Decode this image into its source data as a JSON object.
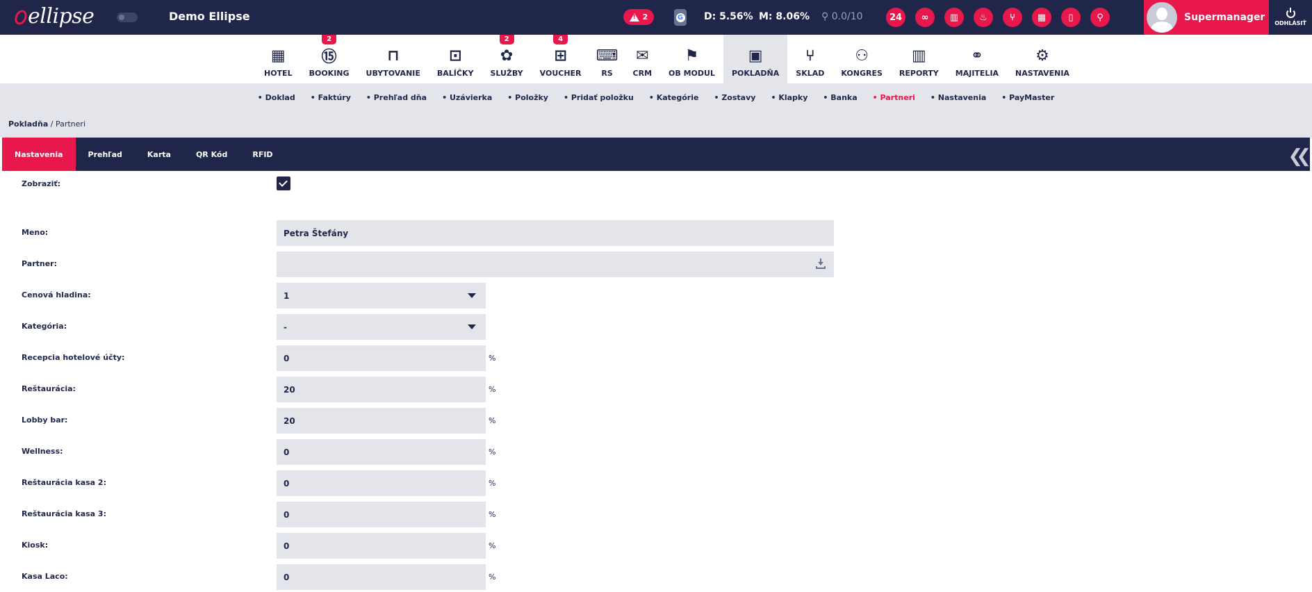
{
  "app": {
    "logo": "ellipse",
    "hotel_name": "Demo Ellipse"
  },
  "topbar": {
    "alert_count": "2",
    "stat_d": "D: 5.56%",
    "stat_m": "M: 8.06%",
    "stat_p": "0.0/10",
    "user_name": "Supermanager",
    "logout_label": "ODHLÁSIŤ"
  },
  "mainnav": [
    {
      "label": "HOTEL",
      "icon": "hotel-icon",
      "badge": ""
    },
    {
      "label": "BOOKING",
      "icon": "calendar-icon",
      "badge": "2"
    },
    {
      "label": "UBYTOVANIE",
      "icon": "bed-icon",
      "badge": ""
    },
    {
      "label": "BALÍČKY",
      "icon": "package-icon",
      "badge": ""
    },
    {
      "label": "SLUŽBY",
      "icon": "lotus-icon",
      "badge": "2"
    },
    {
      "label": "VOUCHER",
      "icon": "gift-icon",
      "badge": "4"
    },
    {
      "label": "RS",
      "icon": "code-window-icon",
      "badge": ""
    },
    {
      "label": "CRM",
      "icon": "mail-icon",
      "badge": ""
    },
    {
      "label": "OB MODUL",
      "icon": "traveler-icon",
      "badge": ""
    },
    {
      "label": "POKLADŇA",
      "icon": "wallet-icon",
      "badge": ""
    },
    {
      "label": "SKLAD",
      "icon": "cutlery-icon",
      "badge": ""
    },
    {
      "label": "KONGRES",
      "icon": "group-icon",
      "badge": ""
    },
    {
      "label": "REPORTY",
      "icon": "bar-chart-icon",
      "badge": ""
    },
    {
      "label": "MAJITELIA",
      "icon": "handshake-icon",
      "badge": ""
    },
    {
      "label": "NASTAVENIA",
      "icon": "gears-icon",
      "badge": ""
    }
  ],
  "subnav": [
    "Doklad",
    "Faktúry",
    "Prehľad dňa",
    "Uzávierka",
    "Položky",
    "Pridať položku",
    "Kategórie",
    "Zostavy",
    "Klapky",
    "Banka",
    "Partneri",
    "Nastavenia",
    "PayMaster"
  ],
  "breadcrumb": {
    "root": "Pokladňa",
    "current": "/ Partneri"
  },
  "tabs": [
    "Nastavenia",
    "Prehľad",
    "Karta",
    "QR Kód",
    "RFID"
  ],
  "form": {
    "zobrazit_label": "Zobraziť:",
    "meno_label": "Meno:",
    "meno_value": "Petra Štefány",
    "partner_label": "Partner:",
    "partner_value": "",
    "cenova_label": "Cenová hladina:",
    "cenova_value": "1",
    "kategoria_label": "Kategória:",
    "kategoria_value": "-",
    "percent": "%",
    "discounts": [
      {
        "label": "Recepcia hotelové účty:",
        "value": "0"
      },
      {
        "label": "Reštaurácia:",
        "value": "20"
      },
      {
        "label": "Lobby bar:",
        "value": "20"
      },
      {
        "label": "Wellness:",
        "value": "0"
      },
      {
        "label": "Reštaurácia kasa 2:",
        "value": "0"
      },
      {
        "label": "Reštaurácia kasa 3:",
        "value": "0"
      },
      {
        "label": "Kiosk:",
        "value": "0"
      },
      {
        "label": "Kasa Laco:",
        "value": "0"
      }
    ]
  },
  "colors": {
    "navy": "#1f2649",
    "accent": "#e8174c",
    "grey": "#e4e5ea"
  }
}
